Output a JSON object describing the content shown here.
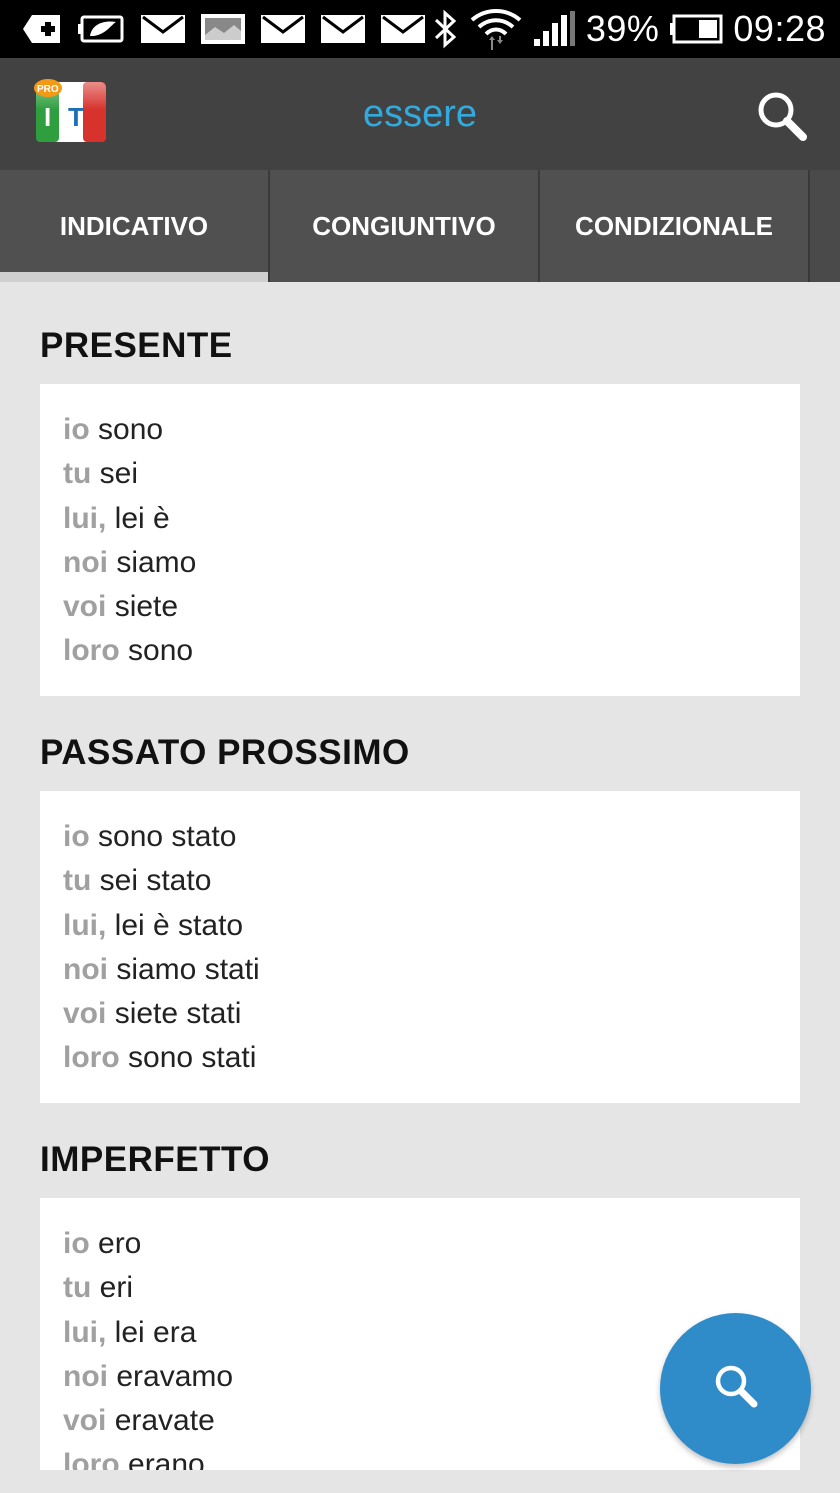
{
  "status_bar": {
    "battery_percent": "39%",
    "time": "09:28",
    "icons": [
      "plus-box-icon",
      "battery-saver-icon",
      "mail-icon",
      "image-icon",
      "mail-icon",
      "mail-icon",
      "mail-icon",
      "bluetooth-icon",
      "wifi-icon",
      "signal-icon",
      "battery-icon"
    ]
  },
  "app_bar": {
    "logo_badge": "PRO",
    "logo_letters": "IT",
    "title": "essere",
    "search_icon": "search-icon"
  },
  "tabs": [
    {
      "label": "INDICATIVO",
      "active": true
    },
    {
      "label": "CONGIUNTIVO",
      "active": false
    },
    {
      "label": "CONDIZIONALE",
      "active": false
    }
  ],
  "sections": [
    {
      "title": "PRESENTE",
      "rows": [
        {
          "pronoun": "io",
          "form": " sono"
        },
        {
          "pronoun": "tu",
          "form": " sei"
        },
        {
          "pronoun": "lui,",
          "form": " lei è"
        },
        {
          "pronoun": "noi",
          "form": " siamo"
        },
        {
          "pronoun": "voi",
          "form": " siete"
        },
        {
          "pronoun": "loro",
          "form": " sono"
        }
      ]
    },
    {
      "title": "PASSATO PROSSIMO",
      "rows": [
        {
          "pronoun": "io",
          "form": " sono stato"
        },
        {
          "pronoun": "tu",
          "form": " sei stato"
        },
        {
          "pronoun": "lui,",
          "form": " lei è stato"
        },
        {
          "pronoun": "noi",
          "form": " siamo stati"
        },
        {
          "pronoun": "voi",
          "form": " siete stati"
        },
        {
          "pronoun": "loro",
          "form": " sono stati"
        }
      ]
    },
    {
      "title": "IMPERFETTO",
      "rows": [
        {
          "pronoun": "io",
          "form": " ero"
        },
        {
          "pronoun": "tu",
          "form": " eri"
        },
        {
          "pronoun": "lui,",
          "form": " lei era"
        },
        {
          "pronoun": "noi",
          "form": " eravamo"
        },
        {
          "pronoun": "voi",
          "form": " eravate"
        },
        {
          "pronoun": "loro",
          "form": " erano"
        }
      ]
    }
  ],
  "fab": {
    "icon": "search-icon"
  },
  "colors": {
    "accent": "#33aadd",
    "fab": "#2f8cc8",
    "appbar": "#424242",
    "tabs": "#505050",
    "background": "#e5e5e5",
    "pronoun": "#a0a0a0"
  }
}
